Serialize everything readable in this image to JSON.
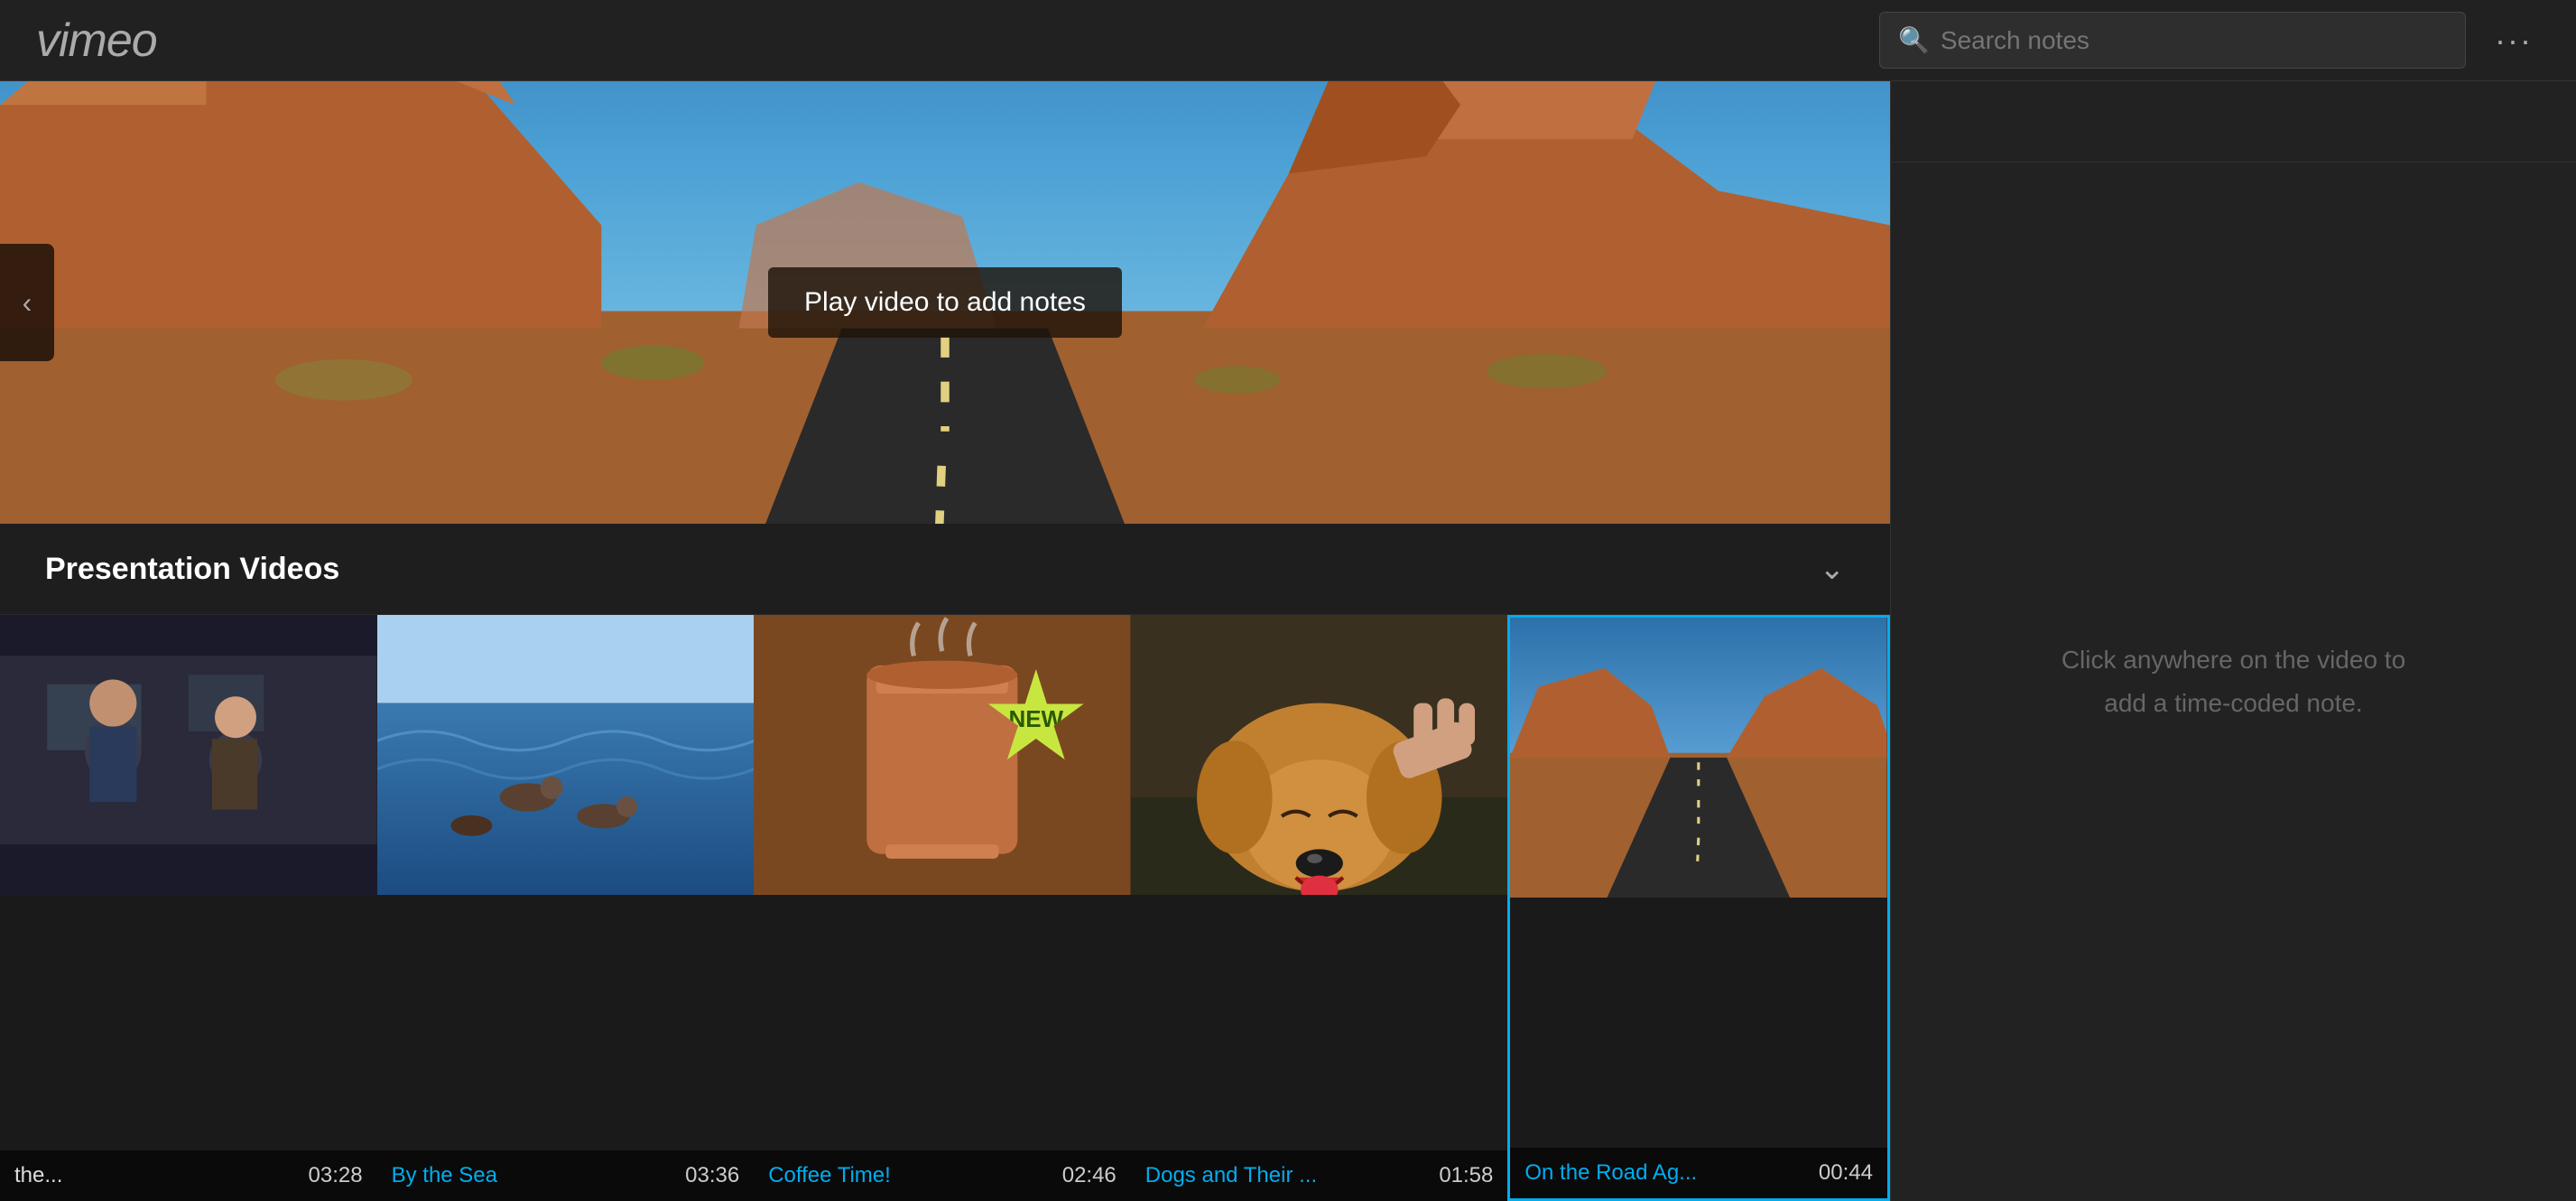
{
  "header": {
    "logo": "vimeo",
    "search_placeholder": "Search notes",
    "more_label": "···"
  },
  "notes_panel": {
    "empty_message": "Click anywhere on the video to\nadd a time-coded note."
  },
  "video_overlay": {
    "play_message": "Play video to add notes"
  },
  "section": {
    "title": "Presentation Videos",
    "chevron": "⌄"
  },
  "thumbnails": [
    {
      "id": "thumb-1",
      "title": "the...",
      "title_color": "white",
      "duration": "03:28",
      "active": false,
      "bg_color": "#2a2a2a",
      "scene": "people"
    },
    {
      "id": "thumb-2",
      "title": "By the Sea",
      "title_color": "blue",
      "duration": "03:36",
      "active": false,
      "bg_color": "#1a3a5c",
      "scene": "sea"
    },
    {
      "id": "thumb-3",
      "title": "Coffee Time!",
      "title_color": "blue",
      "duration": "02:46",
      "active": false,
      "bg_color": "#5c3a1a",
      "scene": "coffee",
      "has_new_badge": true
    },
    {
      "id": "thumb-4",
      "title": "Dogs and Their ...",
      "title_color": "blue",
      "duration": "01:58",
      "active": false,
      "bg_color": "#2a2a1a",
      "scene": "dog"
    },
    {
      "id": "thumb-5",
      "title": "On the Road Ag...",
      "title_color": "blue",
      "duration": "00:44",
      "active": true,
      "bg_color": "#1a3040",
      "scene": "road"
    }
  ]
}
